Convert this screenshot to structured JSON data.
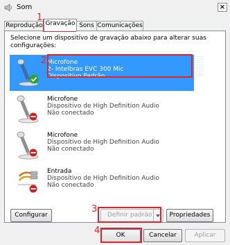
{
  "window": {
    "title": "Som",
    "close_glyph": "×",
    "icon": "speaker-icon"
  },
  "tabs": [
    {
      "label": "Reprodução",
      "active": false
    },
    {
      "label": "Gravação",
      "active": true
    },
    {
      "label": "Sons",
      "active": false
    },
    {
      "label": "Comunicações",
      "active": false
    }
  ],
  "instruction": "Selecione um dispositivo de gravação abaixo para alterar suas configurações:",
  "devices": [
    {
      "name": "Microfone",
      "description": "2- Intelbras EVC 300 Mic",
      "status": "Dispositivo Padrão",
      "selected": true,
      "icon": "microphone-icon",
      "badge": "check-badge-icon"
    },
    {
      "name": "Microfone",
      "description": "Dispositivo de High Definition Audio",
      "status": "Não conectado",
      "selected": false,
      "icon": "microphone-icon",
      "badge": "disconnected-badge-icon"
    },
    {
      "name": "Microfone",
      "description": "Dispositivo de High Definition Audio",
      "status": "Não conectado",
      "selected": false,
      "icon": "microphone-icon",
      "badge": "disconnected-badge-icon"
    },
    {
      "name": "Entrada",
      "description": "Dispositivo de High Definition Audio",
      "status": "Não conectado",
      "selected": false,
      "icon": "audio-jack-icon",
      "badge": "disconnected-badge-icon"
    }
  ],
  "buttons": {
    "configure": "Configurar",
    "set_default": "Definir padrão",
    "properties": "Propriedades",
    "ok": "OK",
    "cancel": "Cancelar",
    "apply": "Aplicar"
  },
  "annotations": [
    "1",
    "2",
    "3",
    "4"
  ],
  "colors": {
    "selection": "#3399ff",
    "annotation": "#e0232b",
    "check": "#2aa42a",
    "disconnected": "#d02020"
  }
}
